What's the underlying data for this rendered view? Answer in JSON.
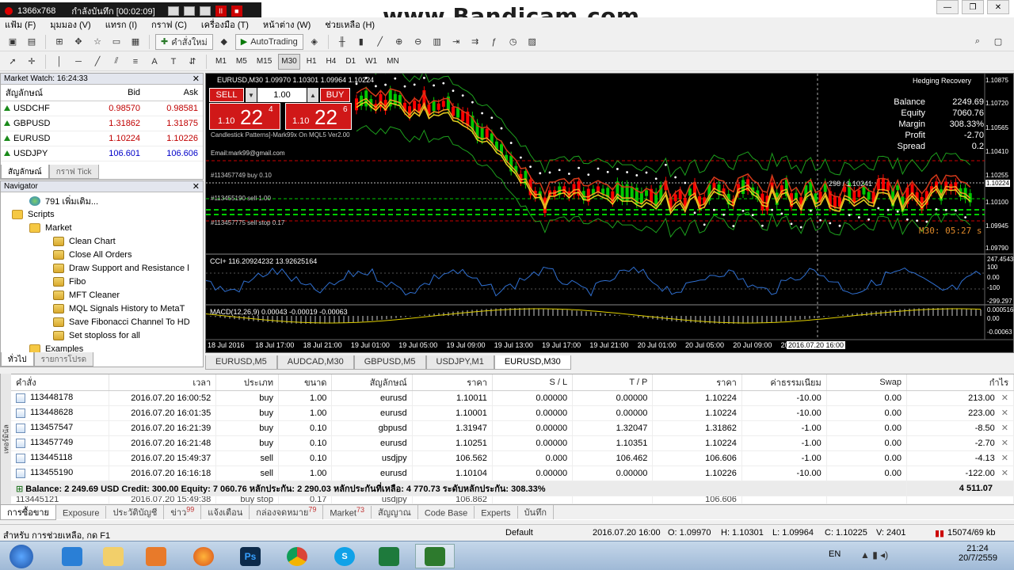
{
  "recorder": {
    "resolution": "1366x768",
    "status": "กำลังบันทึก [00:02:09]"
  },
  "watermark": "www.Bandicam.com",
  "menu": [
    "แฟ้ม (F)",
    "มุมมอง (V)",
    "แทรก (I)",
    "กราฟ (C)",
    "เครื่องมือ (T)",
    "หน้าต่าง (W)",
    "ช่วยเหลือ (H)"
  ],
  "toolbar": {
    "new_order": "คำสั่งใหม่",
    "autotrading": "AutoTrading",
    "timeframes": [
      "M1",
      "M5",
      "M15",
      "M30",
      "H1",
      "H4",
      "D1",
      "W1",
      "MN"
    ],
    "active_timeframe": "M30"
  },
  "market_watch": {
    "title": "Market Watch: 16:24:33",
    "col_symbol": "สัญลักษณ์",
    "col_bid": "Bid",
    "col_ask": "Ask",
    "rows": [
      {
        "symbol": "USDCHF",
        "bid": "0.98570",
        "ask": "0.98581",
        "dir": "up",
        "color": "red"
      },
      {
        "symbol": "GBPUSD",
        "bid": "1.31862",
        "ask": "1.31875",
        "dir": "up",
        "color": "red"
      },
      {
        "symbol": "EURUSD",
        "bid": "1.10224",
        "ask": "1.10226",
        "dir": "up",
        "color": "red"
      },
      {
        "symbol": "USDJPY",
        "bid": "106.601",
        "ask": "106.606",
        "dir": "up",
        "color": "blue"
      }
    ],
    "tabs": [
      "สัญลักษณ์",
      "กราฟ Tick"
    ]
  },
  "navigator": {
    "title": "Navigator",
    "items": [
      {
        "label": "791 เพิ่มเติม...",
        "indent": 36,
        "icon": "globe"
      },
      {
        "label": "Scripts",
        "indent": 14,
        "icon": "folder"
      },
      {
        "label": "Market",
        "indent": 36,
        "icon": "folder"
      },
      {
        "label": "Clean Chart",
        "indent": 66,
        "icon": "scroll"
      },
      {
        "label": "Close All Orders",
        "indent": 66,
        "icon": "scroll"
      },
      {
        "label": "Draw Support and Resistance l",
        "indent": 66,
        "icon": "scroll"
      },
      {
        "label": "Fibo",
        "indent": 66,
        "icon": "scroll"
      },
      {
        "label": "MFT Cleaner",
        "indent": 66,
        "icon": "scroll"
      },
      {
        "label": "MQL Signals History to MetaT",
        "indent": 66,
        "icon": "scroll"
      },
      {
        "label": "Save Fibonacci Channel To HD",
        "indent": 66,
        "icon": "scroll"
      },
      {
        "label": "Set stoploss for all",
        "indent": 66,
        "icon": "scroll"
      },
      {
        "label": "Examples",
        "indent": 36,
        "icon": "folder"
      }
    ],
    "tabs": [
      "ทั่วไป",
      "รายการโปรด"
    ]
  },
  "chart": {
    "header": "EURUSD,M30  1.09970 1.10301 1.09964 1.10224",
    "sell_label": "SELL",
    "buy_label": "BUY",
    "lot": "1.00",
    "sell_price_small": "1.10",
    "sell_price_big": "22",
    "sell_price_sup": "4",
    "buy_price_small": "1.10",
    "buy_price_big": "22",
    "buy_price_sup": "6",
    "indicator_text": "Candlestick Patterns]-Mark99x On MQL5 Ver2.00",
    "email": "Email:mark99@gmail.com",
    "order_lines": [
      "#113457749 buy 0.10",
      "#113455190 sell 1.00",
      "#113457775 sell stop 0.17"
    ],
    "hedging": {
      "title": "Hedging Recovery",
      "rows": [
        {
          "label": "Balance",
          "value": "2249.69"
        },
        {
          "label": "Equity",
          "value": "7060.76"
        },
        {
          "label": "Margin",
          "value": "308.33%"
        },
        {
          "label": "Profit",
          "value": "-2.70"
        },
        {
          "label": "Spread",
          "value": "0.2"
        }
      ]
    },
    "crosshair_readout": "298 / 1.10241",
    "timer_label": "M30: 05:27 s",
    "price_scale": [
      "1.10875",
      "1.10720",
      "1.10565",
      "1.10410",
      "1.10255",
      "1.10224",
      "1.10100",
      "1.09945",
      "1.09790"
    ],
    "cci_label": "CCI+ 116.20924232 13.92625164",
    "cci_scale": [
      "247.4543",
      "100",
      "0.00",
      "-100",
      "-299.297"
    ],
    "macd_label": "MACD(12,26,9) 0.00043 -0.00019 -0.00063",
    "macd_scale": [
      "0.000516",
      "0.00",
      "-0.00063"
    ],
    "time_axis": [
      "18 Jul 2016",
      "18 Jul 17:00",
      "18 Jul 21:00",
      "19 Jul 01:00",
      "19 Jul 05:00",
      "19 Jul 09:00",
      "19 Jul 13:00",
      "19 Jul 17:00",
      "19 Jul 21:00",
      "20 Jul 01:00",
      "20 Jul 05:00",
      "20 Jul 09:00",
      "20",
      "2016.07.20 16:00"
    ],
    "tabs": [
      "EURUSD,M5",
      "AUDCAD,M30",
      "GBPUSD,M5",
      "USDJPY,M1",
      "EURUSD,M30"
    ],
    "active_tab": "EURUSD,M30"
  },
  "terminal": {
    "columns": [
      "คำสั่ง",
      "เวลา",
      "ประเภท",
      "ขนาด",
      "สัญลักษณ์",
      "ราคา",
      "S / L",
      "T / P",
      "ราคา",
      "ค่าธรรมเนียม",
      "Swap",
      "กำไร"
    ],
    "rows": [
      [
        "113448178",
        "2016.07.20 16:00:52",
        "buy",
        "1.00",
        "eurusd",
        "1.10011",
        "0.00000",
        "0.00000",
        "1.10224",
        "-10.00",
        "0.00",
        "213.00"
      ],
      [
        "113448628",
        "2016.07.20 16:01:35",
        "buy",
        "1.00",
        "eurusd",
        "1.10001",
        "0.00000",
        "0.00000",
        "1.10224",
        "-10.00",
        "0.00",
        "223.00"
      ],
      [
        "113457547",
        "2016.07.20 16:21:39",
        "buy",
        "0.10",
        "gbpusd",
        "1.31947",
        "0.00000",
        "1.32047",
        "1.31862",
        "-1.00",
        "0.00",
        "-8.50"
      ],
      [
        "113457749",
        "2016.07.20 16:21:48",
        "buy",
        "0.10",
        "eurusd",
        "1.10251",
        "0.00000",
        "1.10351",
        "1.10224",
        "-1.00",
        "0.00",
        "-2.70"
      ],
      [
        "113445118",
        "2016.07.20 15:49:37",
        "sell",
        "0.10",
        "usdjpy",
        "106.562",
        "0.000",
        "106.462",
        "106.606",
        "-1.00",
        "0.00",
        "-4.13"
      ],
      [
        "113455190",
        "2016.07.20 16:16:18",
        "sell",
        "1.00",
        "eurusd",
        "1.10104",
        "0.00000",
        "0.00000",
        "1.10226",
        "-10.00",
        "0.00",
        "-122.00"
      ]
    ],
    "summary": "Balance: 2 249.69 USD  Credit: 300.00  Equity: 7 060.76  หลักประกัน: 2 290.03  หลักประกันที่เหลือ: 4 770.73  ระดับหลักประกัน: 308.33%",
    "summary_total": "4 511.07",
    "partial_row": [
      "113445121",
      "2016.07.20 15:49:38",
      "buy stop",
      "0.17",
      "usdjpy",
      "106.862",
      "",
      "",
      "106.606",
      "",
      "",
      ""
    ],
    "side_label": "เทอร์มินัล",
    "tabs": [
      {
        "label": "การซื้อขาย",
        "badge": ""
      },
      {
        "label": "Exposure",
        "badge": ""
      },
      {
        "label": "ประวัติบัญชี",
        "badge": ""
      },
      {
        "label": "ข่าว",
        "badge": "99"
      },
      {
        "label": "แจ้งเตือน",
        "badge": ""
      },
      {
        "label": "กล่องจดหมาย",
        "badge": "79"
      },
      {
        "label": "Market",
        "badge": "73"
      },
      {
        "label": "สัญญาณ",
        "badge": ""
      },
      {
        "label": "Code Base",
        "badge": ""
      },
      {
        "label": "Experts",
        "badge": ""
      },
      {
        "label": "บันทึก",
        "badge": ""
      }
    ]
  },
  "statusbar": {
    "help": "สำหรับ การช่วยเหลือ, กด F1",
    "profile": "Default",
    "datetime": "2016.07.20 16:00",
    "open": "O: 1.09970",
    "high": "H: 1.10301",
    "low": "L: 1.09964",
    "close": "C: 1.10225",
    "volume": "V: 2401",
    "traffic": "15074/69 kb"
  },
  "taskbar": {
    "lang": "EN",
    "time": "21:24",
    "date": "20/7/2559",
    "apps": [
      "internet-explorer",
      "file-explorer",
      "media-player",
      "firefox",
      "photoshop",
      "chrome",
      "skype",
      "excel",
      "metatrader"
    ]
  },
  "colors": {
    "bull": "#00c800",
    "bear": "#ff0000",
    "chart_bg": "#000000",
    "sell_btn": "#d01818",
    "buy_btn": "#d01818"
  }
}
